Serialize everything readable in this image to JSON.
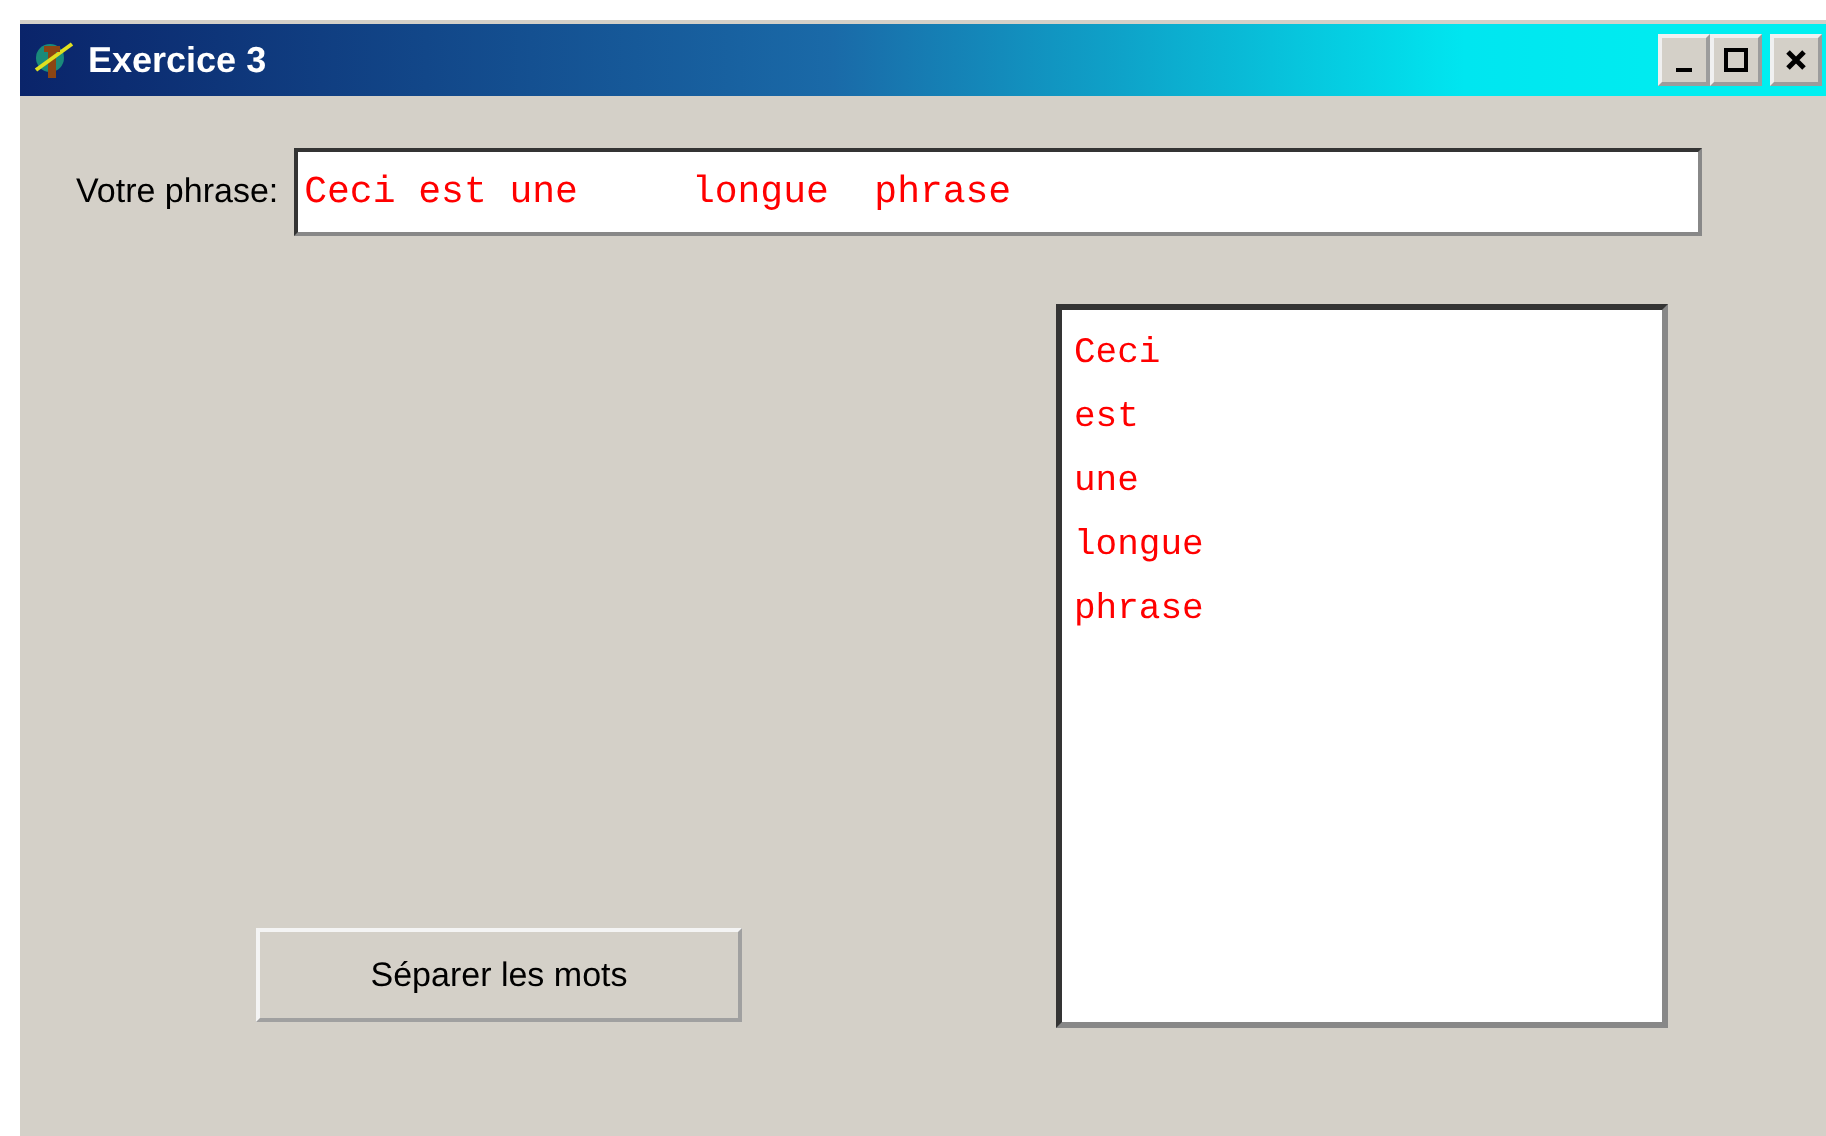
{
  "window": {
    "title": "Exercice 3"
  },
  "phrase": {
    "label": "Votre phrase:",
    "value": "Ceci est une     longue  phrase"
  },
  "words": [
    "Ceci",
    "est",
    "une",
    "longue",
    "phrase"
  ],
  "button": {
    "label": "Séparer les mots"
  }
}
